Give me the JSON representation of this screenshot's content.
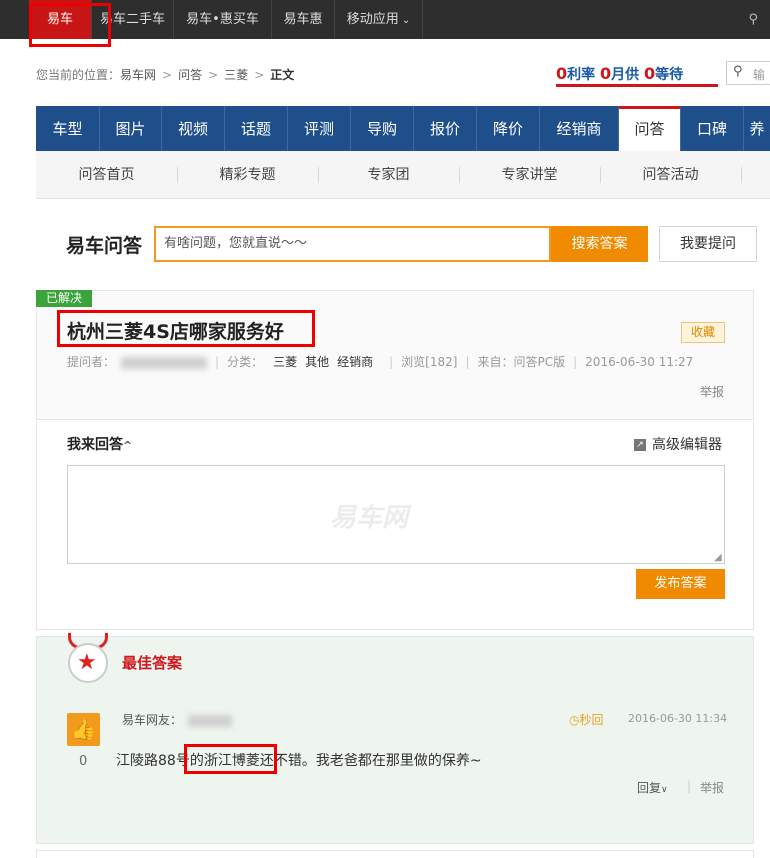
{
  "topbar": {
    "items": [
      "易车",
      "易车二手车",
      "易车•惠买车",
      "易车惠",
      "移动应用"
    ],
    "more_caret": "⌄",
    "location_icon": "location-pin-icon"
  },
  "breadcrumb": {
    "prefix": "您当前的位置：",
    "links": [
      "易车网",
      "问答",
      "三菱"
    ],
    "separator": ">",
    "current": "正文"
  },
  "promo": {
    "zero": "0",
    "items": [
      "利率",
      "月供",
      "等待"
    ]
  },
  "top_search": {
    "placeholder": "输"
  },
  "main_nav": {
    "items": [
      "车型",
      "图片",
      "视频",
      "话题",
      "评测",
      "导购",
      "报价",
      "降价",
      "经销商",
      "问答",
      "口碑",
      "养"
    ],
    "active": "问答"
  },
  "sub_nav": {
    "items": [
      "问答首页",
      "精彩专题",
      "专家团",
      "专家讲堂",
      "问答活动"
    ]
  },
  "ask_bar": {
    "brand": "易车问答",
    "placeholder": "有啥问题，您就直说～～",
    "search_label": "搜索答案",
    "ask_label": "我要提问"
  },
  "question": {
    "badge": "已解决",
    "title": "杭州三菱4S店哪家服务好",
    "favorite": "收藏",
    "asker_label": "提问者：",
    "category_label": "分类：",
    "categories": [
      "三菱",
      "其他",
      "经销商"
    ],
    "views": "浏览[182]",
    "source": "来自：问答PC版",
    "time": "2016-06-30 11:27",
    "report": "举报"
  },
  "answer_form": {
    "heading": "我来回答",
    "caret": "^",
    "editor_label": "高级编辑器",
    "watermark": "易车网",
    "publish": "发布答案"
  },
  "best_answer": {
    "label": "最佳答案",
    "answerer_label": "易车网友：",
    "speed_tag": "秒回",
    "time": "2016-06-30 11:34",
    "likes": "0",
    "text": "江陵路88号的浙江博菱还不错。我老爸都在那里做的保养~",
    "reply": "回复",
    "report": "举报"
  }
}
